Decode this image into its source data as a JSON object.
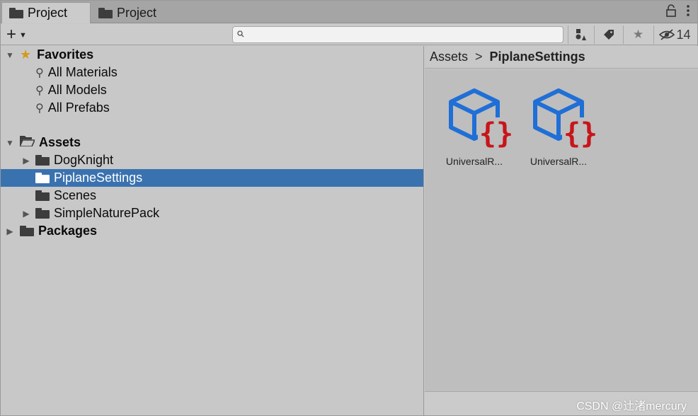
{
  "tabs": [
    {
      "label": "Project",
      "active": true
    },
    {
      "label": "Project",
      "active": false
    }
  ],
  "window_icons": [
    "lock-icon",
    "kebab-menu-icon"
  ],
  "toolbar": {
    "create_symbol": "+",
    "search_placeholder": "",
    "hidden_count": "14"
  },
  "tree": {
    "favorites": {
      "label": "Favorites",
      "items": [
        "All Materials",
        "All Models",
        "All Prefabs"
      ]
    },
    "assets": {
      "label": "Assets",
      "children": [
        "DogKnight",
        "PiplaneSettings",
        "Scenes",
        "SimpleNaturePack"
      ],
      "selected": "PiplaneSettings"
    },
    "packages": {
      "label": "Packages"
    }
  },
  "breadcrumb": {
    "root": "Assets",
    "separator": ">",
    "current": "PiplaneSettings"
  },
  "assets_grid": [
    {
      "label": "UniversalR..."
    },
    {
      "label": "UniversalR..."
    }
  ],
  "watermark": "CSDN @辻渚mercury",
  "colors": {
    "selection": "#3a72b0",
    "icon_blue": "#1f6fd6",
    "icon_red": "#c8151a",
    "star": "#d49a1b"
  }
}
